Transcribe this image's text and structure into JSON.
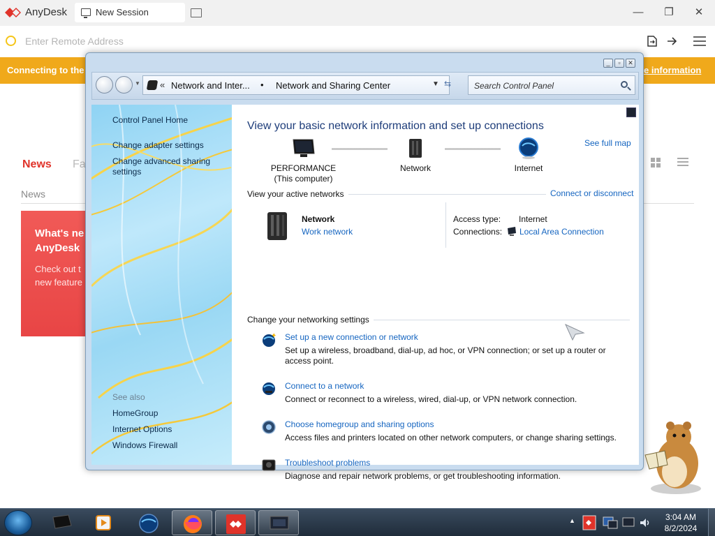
{
  "anydesk": {
    "app_name": "AnyDesk",
    "tab_label": "New Session",
    "address_placeholder": "Enter Remote Address",
    "banner_text": "Connecting to the",
    "banner_link": "e information",
    "tabs": [
      "News",
      "Fa"
    ],
    "section_label": "News",
    "card_title": "What's ne\nAnyDesk",
    "card_text": "Check out t\nnew feature",
    "colors": {
      "brand_red": "#e0332a",
      "banner_orange": "#f0a91b"
    }
  },
  "control_panel": {
    "breadcrumb": [
      "Network and Inter...",
      "Network and Sharing Center"
    ],
    "breadcrumb_separator": "•",
    "search_placeholder": "Search Control Panel",
    "sidebar": {
      "home": "Control Panel Home",
      "links": [
        "Change adapter settings",
        "Change advanced sharing\nsettings"
      ],
      "see_also_label": "See also",
      "see_also": [
        "HomeGroup",
        "Internet Options",
        "Windows Firewall"
      ]
    },
    "heading": "View your basic network information and set up connections",
    "see_full_map": "See full map",
    "map_nodes": [
      "PERFORMANCE\n(This computer)",
      "Network",
      "Internet"
    ],
    "active_networks": {
      "title": "View your active networks",
      "connect_link": "Connect or disconnect",
      "network_name": "Network",
      "network_type": "Work network",
      "access_type_label": "Access type:",
      "access_type_value": "Internet",
      "connections_label": "Connections:",
      "connections_value": "Local Area Connection"
    },
    "settings": {
      "title": "Change your networking settings",
      "tasks": [
        {
          "title": "Set up a new connection or network",
          "desc": "Set up a wireless, broadband, dial-up, ad hoc, or VPN connection; or set up a router or access point."
        },
        {
          "title": "Connect to a network",
          "desc": "Connect or reconnect to a wireless, wired, dial-up, or VPN network connection."
        },
        {
          "title": "Choose homegroup and sharing options",
          "desc": "Access files and printers located on other network computers, or change sharing settings."
        },
        {
          "title": "Troubleshoot problems",
          "desc": "Diagnose and repair network problems, or get troubleshooting information."
        }
      ]
    }
  },
  "taskbar": {
    "time": "3:04 AM",
    "date": "8/2/2024"
  }
}
